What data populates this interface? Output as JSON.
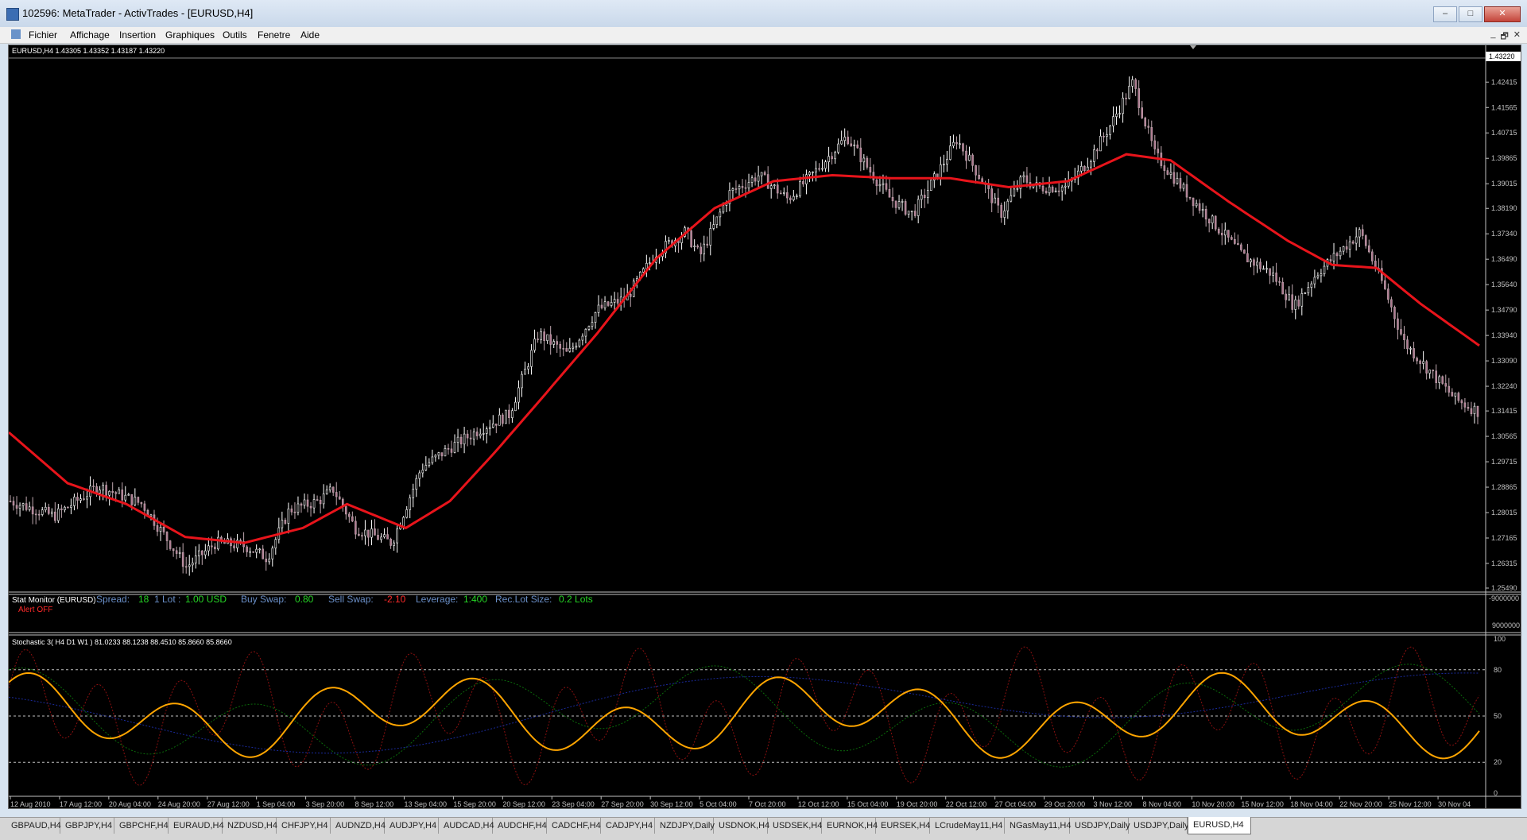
{
  "window": {
    "title": "102596: MetaTrader - ActivTrades - [EURUSD,H4]",
    "min": "–",
    "max": "□",
    "close": "✕"
  },
  "menu": [
    "Fichier",
    "Affichage",
    "Insertion",
    "Graphiques",
    "Outils",
    "Fenetre",
    "Aide"
  ],
  "mdi": [
    "_",
    "🗗",
    "✕"
  ],
  "chart": {
    "info": "EURUSD,H4  1.43305 1.43352 1.43187 1.43220",
    "current_price": "1.43220",
    "price_labels": [
      "1.42415",
      "1.41565",
      "1.40715",
      "1.39865",
      "1.39015",
      "1.38190",
      "1.37340",
      "1.36490",
      "1.35640",
      "1.34790",
      "1.33940",
      "1.33090",
      "1.32240",
      "1.31415",
      "1.30565",
      "1.29715",
      "1.28865",
      "1.28015",
      "1.27165",
      "1.26315",
      "1.25490"
    ],
    "colors": {
      "candle": "#ffffff",
      "ma": "#e8141b",
      "grid": "#c0c0c0"
    }
  },
  "stat_monitor": {
    "title": "Stat Monitor (EURUSD)",
    "spread_label": "Spread:",
    "spread": "18",
    "lot_label": "1 Lot :",
    "lot": "1.00 USD",
    "buy_label": "Buy Swap:",
    "buy": "0.80",
    "sell_label": "Sell Swap:",
    "sell": "-2.10",
    "lev_label": "Leverage:",
    "lev": "1:400",
    "rec_label": "Rec.Lot Size:",
    "rec": "0.2 Lots",
    "alert": "Alert OFF",
    "scale_top": "9000000",
    "scale_bot": "-9000000"
  },
  "stochastic": {
    "info": "Stochastic 3( H4   D1   W1  ) 81.0233 88.1238 88.4510 85.8660 85.8660",
    "levels": [
      "100",
      "80",
      "50",
      "20",
      "0"
    ]
  },
  "time_labels": [
    "12 Aug 2010",
    "17 Aug 12:00",
    "20 Aug 04:00",
    "24 Aug 20:00",
    "27 Aug 12:00",
    "1 Sep 04:00",
    "3 Sep 20:00",
    "8 Sep 12:00",
    "13 Sep 04:00",
    "15 Sep 20:00",
    "20 Sep 12:00",
    "23 Sep 04:00",
    "27 Sep 20:00",
    "30 Sep 12:00",
    "5 Oct 04:00",
    "7 Oct 20:00",
    "12 Oct 12:00",
    "15 Oct 04:00",
    "19 Oct 20:00",
    "22 Oct 12:00",
    "27 Oct 04:00",
    "29 Oct 20:00",
    "3 Nov 12:00",
    "8 Nov 04:00",
    "10 Nov 20:00",
    "15 Nov 12:00",
    "18 Nov 04:00",
    "22 Nov 20:00",
    "25 Nov 12:00",
    "30 Nov 04"
  ],
  "tabs": [
    "GBPAUD,H4",
    "GBPJPY,H4",
    "GBPCHF,H4",
    "EURAUD,H4",
    "NZDUSD,H4",
    "CHFJPY,H4",
    "AUDNZD,H4",
    "AUDJPY,H4",
    "AUDCAD,H4",
    "AUDCHF,H4",
    "CADCHF,H4",
    "CADJPY,H4",
    "NZDJPY,Daily",
    "USDNOK,H4",
    "USDSEK,H4",
    "EURNOK,H4",
    "EURSEK,H4",
    "LCrudeMay11,H4",
    "NGasMay11,H4",
    "USDJPY,Daily",
    "USDJPY,Daily",
    "EURUSD,H4"
  ],
  "price_series": {
    "anchors": [
      [
        0,
        1.284
      ],
      [
        0.03,
        1.279
      ],
      [
        0.06,
        1.289
      ],
      [
        0.09,
        1.283
      ],
      [
        0.12,
        1.262
      ],
      [
        0.14,
        1.27
      ],
      [
        0.16,
        1.269
      ],
      [
        0.175,
        1.265
      ],
      [
        0.19,
        1.281
      ],
      [
        0.21,
        1.284
      ],
      [
        0.22,
        1.288
      ],
      [
        0.235,
        1.275
      ],
      [
        0.26,
        1.27
      ],
      [
        0.28,
        1.295
      ],
      [
        0.3,
        1.302
      ],
      [
        0.32,
        1.308
      ],
      [
        0.34,
        1.313
      ],
      [
        0.36,
        1.34
      ],
      [
        0.38,
        1.333
      ],
      [
        0.4,
        1.348
      ],
      [
        0.42,
        1.352
      ],
      [
        0.44,
        1.367
      ],
      [
        0.46,
        1.374
      ],
      [
        0.47,
        1.366
      ],
      [
        0.49,
        1.387
      ],
      [
        0.51,
        1.393
      ],
      [
        0.53,
        1.385
      ],
      [
        0.55,
        1.395
      ],
      [
        0.57,
        1.406
      ],
      [
        0.585,
        1.395
      ],
      [
        0.6,
        1.385
      ],
      [
        0.615,
        1.38
      ],
      [
        0.63,
        1.392
      ],
      [
        0.645,
        1.405
      ],
      [
        0.66,
        1.393
      ],
      [
        0.675,
        1.38
      ],
      [
        0.69,
        1.392
      ],
      [
        0.7,
        1.389
      ],
      [
        0.72,
        1.389
      ],
      [
        0.735,
        1.398
      ],
      [
        0.75,
        1.41
      ],
      [
        0.765,
        1.424
      ],
      [
        0.78,
        1.4
      ],
      [
        0.8,
        1.388
      ],
      [
        0.82,
        1.377
      ],
      [
        0.84,
        1.366
      ],
      [
        0.86,
        1.36
      ],
      [
        0.875,
        1.349
      ],
      [
        0.89,
        1.36
      ],
      [
        0.905,
        1.367
      ],
      [
        0.92,
        1.374
      ],
      [
        0.935,
        1.357
      ],
      [
        0.95,
        1.337
      ],
      [
        0.97,
        1.326
      ],
      [
        0.985,
        1.318
      ],
      [
        1.0,
        1.314
      ]
    ]
  },
  "ma_series": {
    "anchors": [
      [
        0,
        1.307
      ],
      [
        0.04,
        1.29
      ],
      [
        0.08,
        1.283
      ],
      [
        0.12,
        1.272
      ],
      [
        0.16,
        1.27
      ],
      [
        0.2,
        1.275
      ],
      [
        0.23,
        1.283
      ],
      [
        0.27,
        1.275
      ],
      [
        0.3,
        1.284
      ],
      [
        0.33,
        1.3
      ],
      [
        0.36,
        1.317
      ],
      [
        0.4,
        1.34
      ],
      [
        0.44,
        1.365
      ],
      [
        0.48,
        1.382
      ],
      [
        0.52,
        1.391
      ],
      [
        0.56,
        1.393
      ],
      [
        0.6,
        1.392
      ],
      [
        0.64,
        1.392
      ],
      [
        0.68,
        1.389
      ],
      [
        0.72,
        1.391
      ],
      [
        0.76,
        1.4
      ],
      [
        0.79,
        1.398
      ],
      [
        0.83,
        1.384
      ],
      [
        0.87,
        1.371
      ],
      [
        0.9,
        1.363
      ],
      [
        0.93,
        1.362
      ],
      [
        0.96,
        1.35
      ],
      [
        1.0,
        1.336
      ]
    ]
  }
}
